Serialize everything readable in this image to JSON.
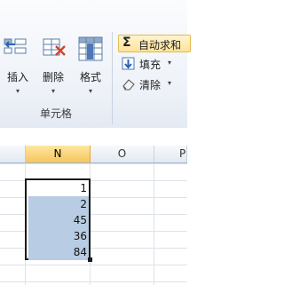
{
  "ribbon": {
    "cells_group": {
      "label": "单元格",
      "insert_label": "插入",
      "delete_label": "删除",
      "format_label": "格式",
      "dropdown_glyph": "▾"
    },
    "editing": {
      "autosum_label": "自动求和",
      "autosum_icon": "Σ",
      "fill_label": "填充",
      "clear_label": "清除",
      "dropdown_glyph": "▾"
    },
    "colors": {
      "autosum_bg": "#fde39a",
      "selected_header": "#f7c55c",
      "cell_highlight": "#b8cce4"
    }
  },
  "sheet": {
    "columns": [
      "N",
      "O",
      "P"
    ],
    "selected_column": "N",
    "selected_values": [
      "1",
      "2",
      "45",
      "36",
      "84"
    ]
  }
}
